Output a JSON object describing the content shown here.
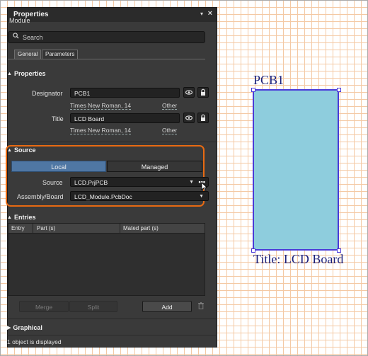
{
  "panel": {
    "title": "Properties",
    "pin_glyph": "▾",
    "close_glyph": "×",
    "subtitle": "Module",
    "search_placeholder": "Search",
    "tabs": [
      {
        "label": "General"
      },
      {
        "label": "Parameters"
      }
    ],
    "properties_section": {
      "header": "Properties",
      "designator_label": "Designator",
      "designator_value": "PCB1",
      "designator_font": "Times New Roman, 14",
      "designator_other": "Other",
      "title_label": "Title",
      "title_value": "LCD Board",
      "title_font": "Times New Roman, 14",
      "title_other": "Other"
    },
    "source_section": {
      "header": "Source",
      "mode_local": "Local",
      "mode_managed": "Managed",
      "source_label": "Source",
      "source_value": "LCD.PrjPCB",
      "assembly_label": "Assembly/Board",
      "assembly_value": "LCD_Module.PcbDoc"
    },
    "entries_section": {
      "header": "Entries",
      "columns": [
        "Entry",
        "Part (s)",
        "Mated part (s)"
      ],
      "buttons": {
        "merge": "Merge",
        "split": "Split",
        "add": "Add"
      }
    },
    "graphical_section": {
      "header": "Graphical"
    },
    "status": "1 object is displayed"
  },
  "canvas": {
    "designator": "PCB1",
    "title_text": "Title: LCD Board",
    "fill_color": "#8ecddd",
    "outline_color": "#4a3ad8",
    "text_color": "#1a1f7a"
  },
  "colors": {
    "highlight": "#e86a12",
    "accent": "#4f77a4"
  }
}
